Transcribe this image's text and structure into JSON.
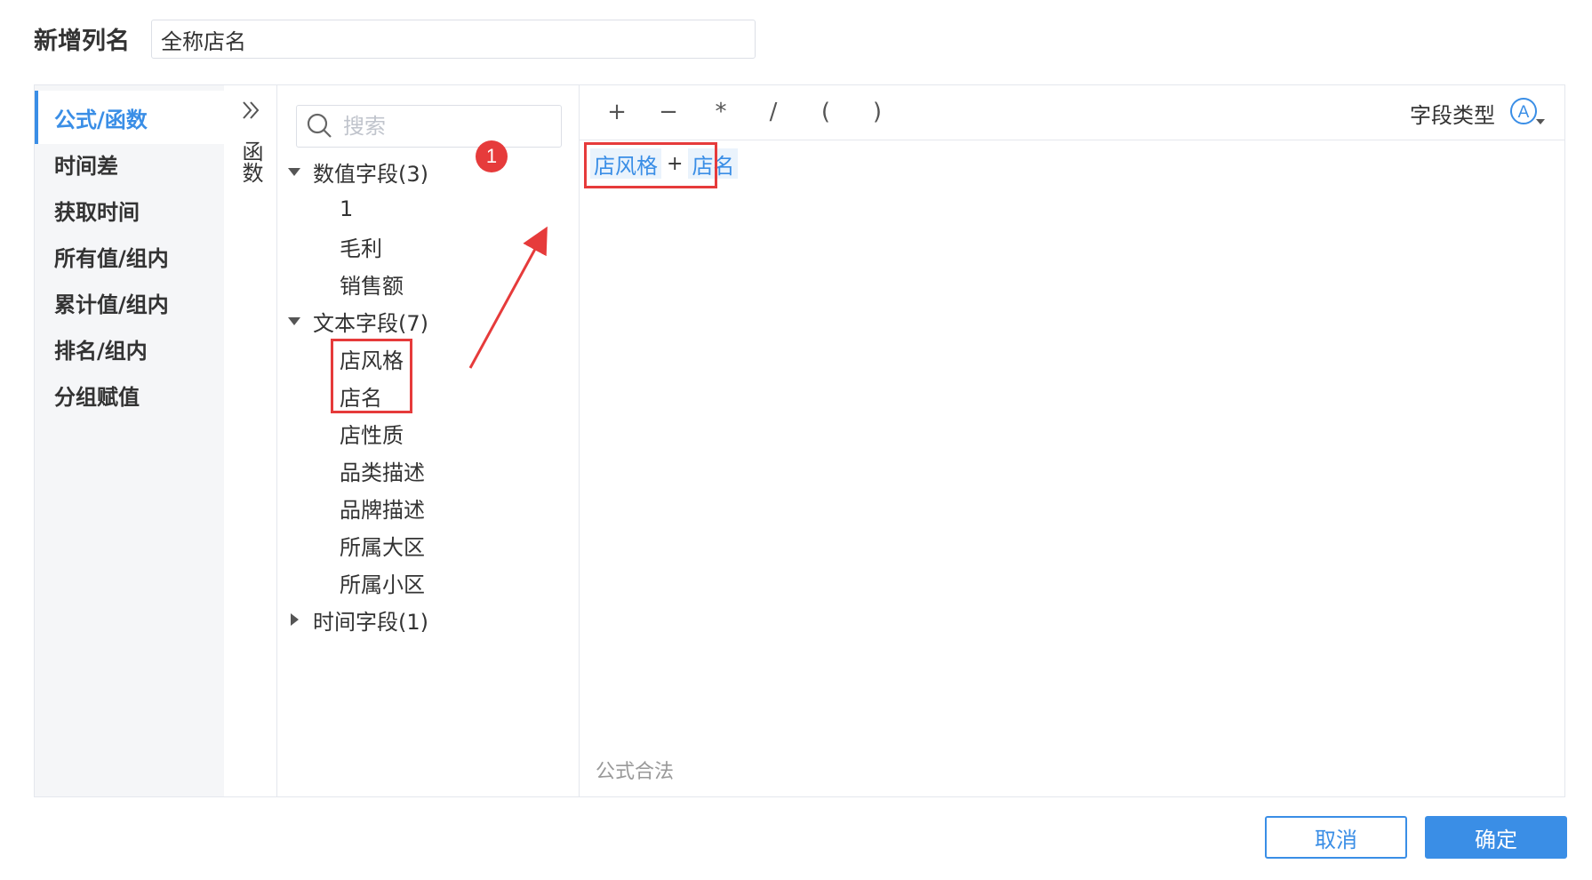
{
  "header": {
    "title": "新增列名",
    "name_value": "全称店名"
  },
  "categories": [
    {
      "label": "公式/函数",
      "active": true
    },
    {
      "label": "时间差",
      "active": false
    },
    {
      "label": "获取时间",
      "active": false
    },
    {
      "label": "所有值/组内",
      "active": false
    },
    {
      "label": "累计值/组内",
      "active": false
    },
    {
      "label": "排名/组内",
      "active": false
    },
    {
      "label": "分组赋值",
      "active": false
    }
  ],
  "function_panel": {
    "label": "函数"
  },
  "search": {
    "placeholder": "搜索"
  },
  "field_groups": [
    {
      "label": "数值字段(3)",
      "expanded": true,
      "items": [
        "1",
        "毛利",
        "销售额"
      ]
    },
    {
      "label": "文本字段(7)",
      "expanded": true,
      "items": [
        "店风格",
        "店名",
        "店性质",
        "品类描述",
        "品牌描述",
        "所属大区",
        "所属小区"
      ]
    },
    {
      "label": "时间字段(1)",
      "expanded": false,
      "items": []
    }
  ],
  "annotation": {
    "step_badge": "1"
  },
  "toolbar": {
    "operators": [
      "+",
      "−",
      "*",
      "/",
      "(",
      ")"
    ],
    "field_type_label": "字段类型",
    "field_type_icon": "A"
  },
  "formula": {
    "tokens": [
      "店风格",
      "店名"
    ],
    "operator": "+",
    "status": "公式合法"
  },
  "footer": {
    "cancel_label": "取消",
    "ok_label": "确定"
  },
  "colors": {
    "accent": "#3a8ee6",
    "highlight": "#e63b3b"
  }
}
